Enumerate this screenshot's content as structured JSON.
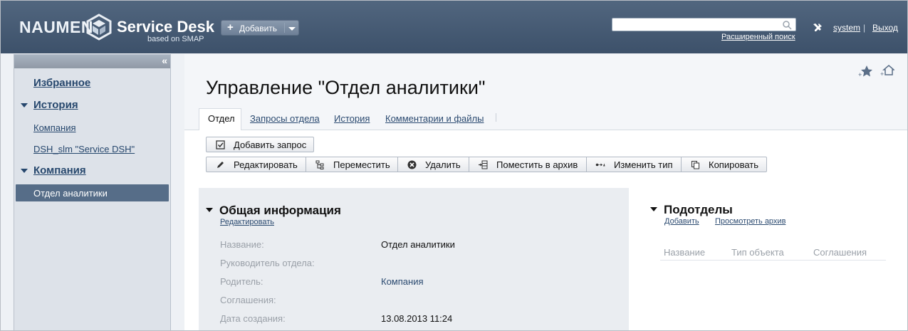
{
  "header": {
    "logo": {
      "brand": "NAUMEN",
      "product": "Service Desk",
      "tagline": "based on SMAP"
    },
    "add_button": {
      "label": "Добавить"
    },
    "search": {
      "value": "",
      "placeholder": ""
    },
    "advanced_search": "Расширенный поиск",
    "user": "system",
    "separator": "|",
    "logout": "Выход"
  },
  "nav": {
    "collapse": "«",
    "favorites": "Избранное",
    "history": {
      "title": "История",
      "items": [
        {
          "label": "Компания"
        },
        {
          "label": "DSH_slm \"Service DSH\""
        }
      ]
    },
    "company": {
      "title": "Компания",
      "items": [
        {
          "label": "Отдел аналитики",
          "active": true
        }
      ]
    }
  },
  "page": {
    "title": "Управление \"Отдел аналитики\"",
    "tabs": [
      {
        "label": "Отдел",
        "active": true
      },
      {
        "label": "Запросы отдела"
      },
      {
        "label": "История"
      },
      {
        "label": "Комментарии и файлы"
      }
    ],
    "actions": {
      "add_request": "Добавить запрос",
      "toolbar": [
        {
          "label": "Редактировать",
          "icon": "pencil-icon"
        },
        {
          "label": "Переместить",
          "icon": "move-icon"
        },
        {
          "label": "Удалить",
          "icon": "delete-icon"
        },
        {
          "label": "Поместить в архив",
          "icon": "archive-icon"
        },
        {
          "label": "Изменить тип",
          "icon": "change-type-icon"
        },
        {
          "label": "Копировать",
          "icon": "copy-icon"
        }
      ]
    },
    "general": {
      "title": "Общая информация",
      "edit_link": "Редактировать",
      "properties": [
        {
          "label": "Название:",
          "value": "Отдел аналитики"
        },
        {
          "label": "Руководитель отдела:",
          "value": ""
        },
        {
          "label": "Родитель:",
          "value": "Компания",
          "is_link": true
        },
        {
          "label": "Соглашения:",
          "value": ""
        },
        {
          "label": "Дата создания:",
          "value": "13.08.2013 11:24"
        }
      ]
    },
    "subdivisions": {
      "title": "Подотделы",
      "add_link": "Добавить",
      "archive_link": "Просмотреть архив",
      "columns": [
        "Название",
        "Тип объекта",
        "Соглашения"
      ]
    }
  },
  "colors": {
    "header_bg": "#475c75",
    "nav_active_bg": "#566d88",
    "link": "#2b4a70"
  }
}
